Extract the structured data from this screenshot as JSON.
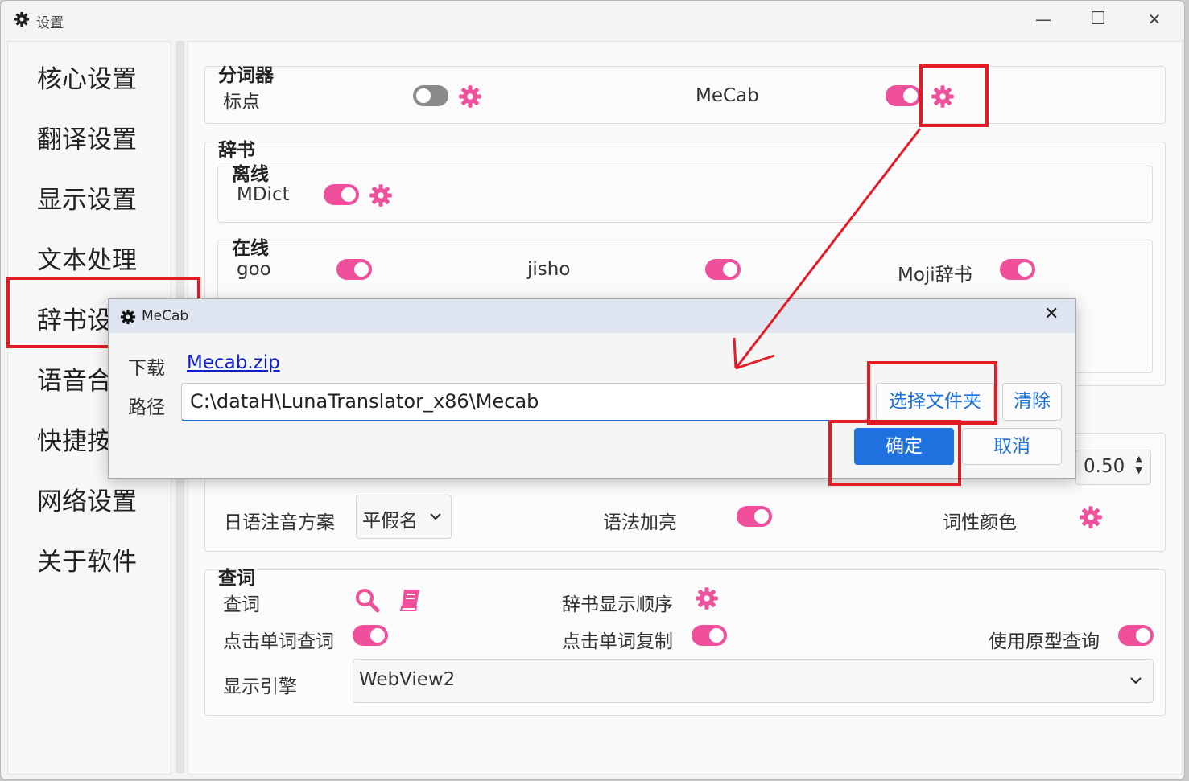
{
  "window": {
    "title": "设置",
    "min_glyph": "—",
    "max_glyph": "☐",
    "close_glyph": "✕"
  },
  "sidebar": {
    "items": [
      {
        "label": "核心设置"
      },
      {
        "label": "翻译设置"
      },
      {
        "label": "显示设置"
      },
      {
        "label": "文本处理"
      },
      {
        "label": "辞书设置"
      },
      {
        "label": "语音合成"
      },
      {
        "label": "快捷按键"
      },
      {
        "label": "网络设置"
      },
      {
        "label": "关于软件"
      }
    ]
  },
  "tokenizer": {
    "title": "分词器",
    "punct_label": "标点",
    "punct_on": false,
    "mecab_label": "MeCab",
    "mecab_on": true
  },
  "dictionary": {
    "title": "辞书",
    "offline": {
      "title": "离线",
      "mdict_label": "MDict",
      "mdict_on": true
    },
    "online": {
      "title": "在线",
      "items": [
        {
          "label": "goo",
          "on": true
        },
        {
          "label": "jisho",
          "on": true
        },
        {
          "label": "Moji辞书",
          "on": true
        }
      ]
    }
  },
  "display": {
    "spin_value": "0.50",
    "furigana_label": "日语注音方案",
    "furigana_value": "平假名",
    "grammar_label": "语法加亮",
    "grammar_on": true,
    "pos_color_label": "词性颜色"
  },
  "lookup": {
    "title": "查词",
    "lookup_label": "查词",
    "order_label": "辞书显示顺序",
    "click_lookup_label": "点击单词查词",
    "click_lookup_on": true,
    "click_copy_label": "点击单词复制",
    "click_copy_on": true,
    "lemma_label": "使用原型查询",
    "lemma_on": true,
    "engine_label": "显示引擎",
    "engine_value": "WebView2"
  },
  "dialog": {
    "title": "MeCab",
    "download_label": "下载",
    "download_link": "Mecab.zip",
    "path_label": "路径",
    "path_value": "C:\\dataH\\LunaTranslator_x86\\Mecab",
    "choose_folder": "选择文件夹",
    "clear": "清除",
    "ok": "确定",
    "cancel": "取消",
    "close_glyph": "✕"
  },
  "colors": {
    "accent": "#f0509b",
    "primary": "#1f72de",
    "annotation": "#e21b24"
  }
}
